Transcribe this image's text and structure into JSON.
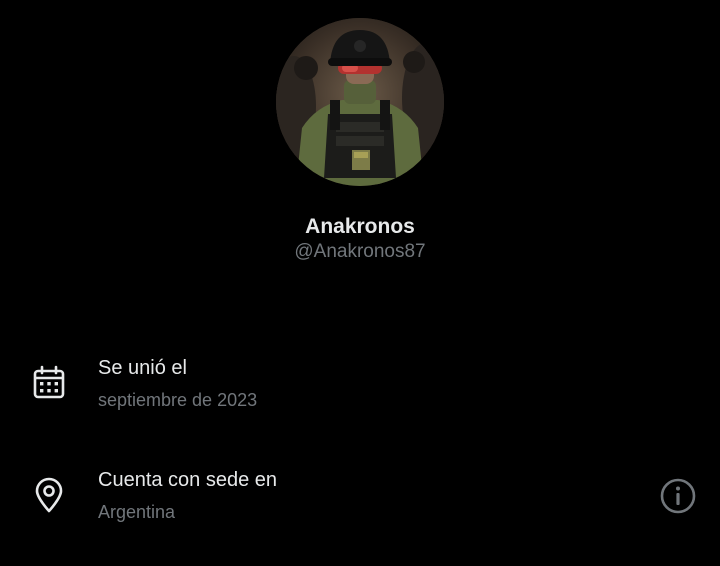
{
  "profile": {
    "display_name": "Anakronos",
    "handle": "@Anakronos87"
  },
  "joined": {
    "title": "Se unió el",
    "value": "septiembre de 2023",
    "icon": "calendar-icon"
  },
  "location": {
    "title": "Cuenta con sede en",
    "value": "Argentina",
    "icon": "location-pin-icon",
    "info_icon": "info-icon"
  },
  "colors": {
    "background": "#000000",
    "primary_text": "#e7e9ea",
    "secondary_text": "#71767b"
  }
}
